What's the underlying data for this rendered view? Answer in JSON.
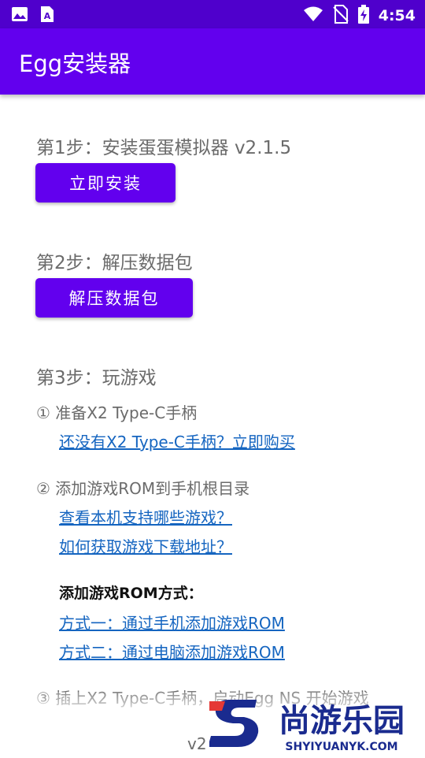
{
  "status_bar": {
    "time": "4:54",
    "icons_left": [
      "image-icon",
      "app-notification-icon"
    ],
    "icons_right": [
      "wifi-icon",
      "no-sim-icon",
      "battery-charging-icon"
    ]
  },
  "app_bar": {
    "title": "Egg安装器",
    "color": "#6200ee"
  },
  "steps": {
    "step1": {
      "title": "第1步：安装蛋蛋模拟器 v2.1.5",
      "button": "立即安装"
    },
    "step2": {
      "title": "第2步：解压数据包",
      "button": "解压数据包"
    },
    "step3": {
      "title": "第3步：玩游戏",
      "item1": {
        "text": "① 准备X2 Type-C手柄",
        "link": "还没有X2 Type-C手柄？立即购买"
      },
      "item2": {
        "text": "② 添加游戏ROM到手机根目录",
        "link1": "查看本机支持哪些游戏？",
        "link2": "如何获取游戏下载地址？",
        "methods_label": "添加游戏ROM方式：",
        "method1": "方式一：通过手机添加游戏ROM",
        "method2": "方式二：通过电脑添加游戏ROM"
      },
      "item3": {
        "text": "③ 插上X2 Type-C手柄，启动Egg NS 开始游戏"
      }
    }
  },
  "footer": {
    "version": "v2"
  },
  "watermark": {
    "brand": "尚游乐园",
    "domain": "SHYIYUANYK.COM"
  }
}
